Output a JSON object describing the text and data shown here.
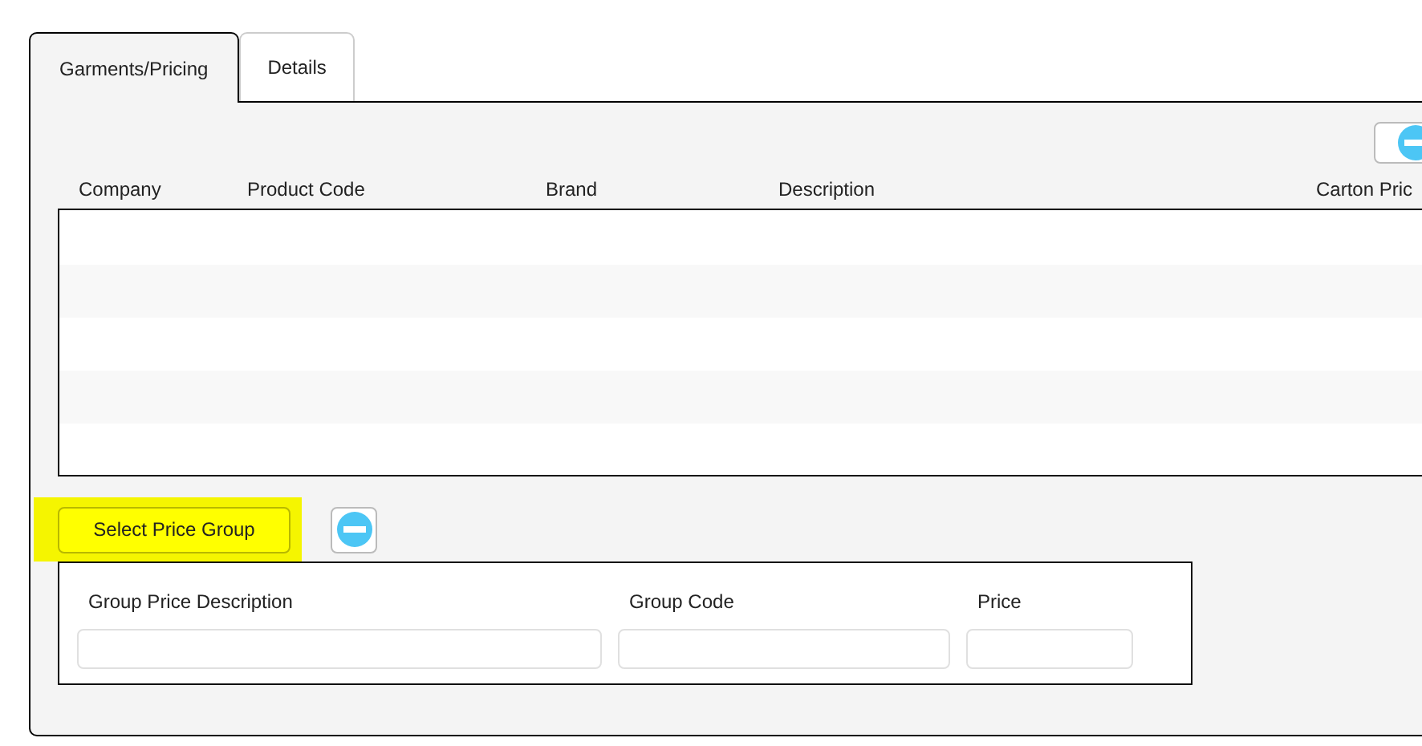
{
  "tabs": [
    {
      "label": "Garments/Pricing",
      "selected": true
    },
    {
      "label": "Details",
      "selected": false
    }
  ],
  "garments_table": {
    "columns": [
      "Company",
      "Product Code",
      "Brand",
      "Description",
      "Carton Pric"
    ]
  },
  "price_group": {
    "select_button": {
      "label": "Select Price Group",
      "highlighted": true
    },
    "fields": [
      {
        "label": "Group Price Description"
      },
      {
        "label": "Group Code"
      },
      {
        "label": "Price"
      }
    ]
  }
}
